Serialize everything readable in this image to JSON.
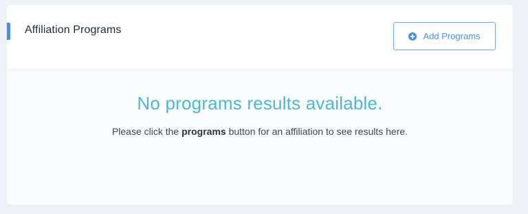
{
  "panel": {
    "title": "Affiliation Programs",
    "add_button_label": "Add Programs",
    "add_button_icon": "plus-circle-icon"
  },
  "empty_state": {
    "heading": "No programs results available.",
    "message_before": "Please click the ",
    "message_emphasis": "programs",
    "message_after": " button for an affiliation to see results here."
  },
  "colors": {
    "accent": "#4a90e2",
    "heading": "#4fb7cf",
    "button_text": "#4a90e2",
    "button_border": "#6ea6e6"
  }
}
